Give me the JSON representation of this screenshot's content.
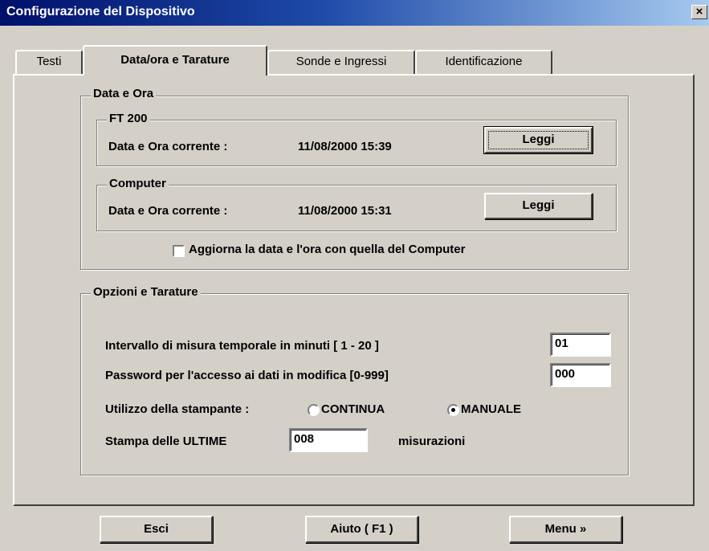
{
  "window": {
    "title": "Configurazione del Dispositivo",
    "close_label": "×"
  },
  "tabs": [
    "Testi",
    "Data/ora e Tarature",
    "Sonde e Ingressi",
    "Identificazione"
  ],
  "datetime_group": {
    "title": "Data e Ora",
    "device": {
      "title": "FT 200",
      "label": "Data e Ora corrente :",
      "value": "11/08/2000 15:39",
      "button": "Leggi"
    },
    "computer": {
      "title": "Computer",
      "label": "Data e Ora corrente :",
      "value": "11/08/2000 15:31",
      "button": "Leggi"
    },
    "sync_checkbox": {
      "label": "Aggiorna la data e l'ora con quella del Computer",
      "checked": false
    }
  },
  "options_group": {
    "title": "Opzioni e Tarature",
    "interval": {
      "label": "Intervallo di misura temporale in minuti  [ 1 - 20 ]",
      "value": "01"
    },
    "password": {
      "label": "Password per l'accesso ai dati in modifica  [0-999]",
      "value": "000"
    },
    "printer": {
      "label": "Utilizzo della stampante :",
      "options": [
        "CONTINUA",
        "MANUALE"
      ],
      "selected": "MANUALE"
    },
    "print_last": {
      "label": "Stampa delle ULTIME",
      "value": "008",
      "suffix": "misurazioni"
    }
  },
  "footer": {
    "exit": "Esci",
    "help": "Aiuto ( F1 )",
    "menu": "Menu »"
  }
}
